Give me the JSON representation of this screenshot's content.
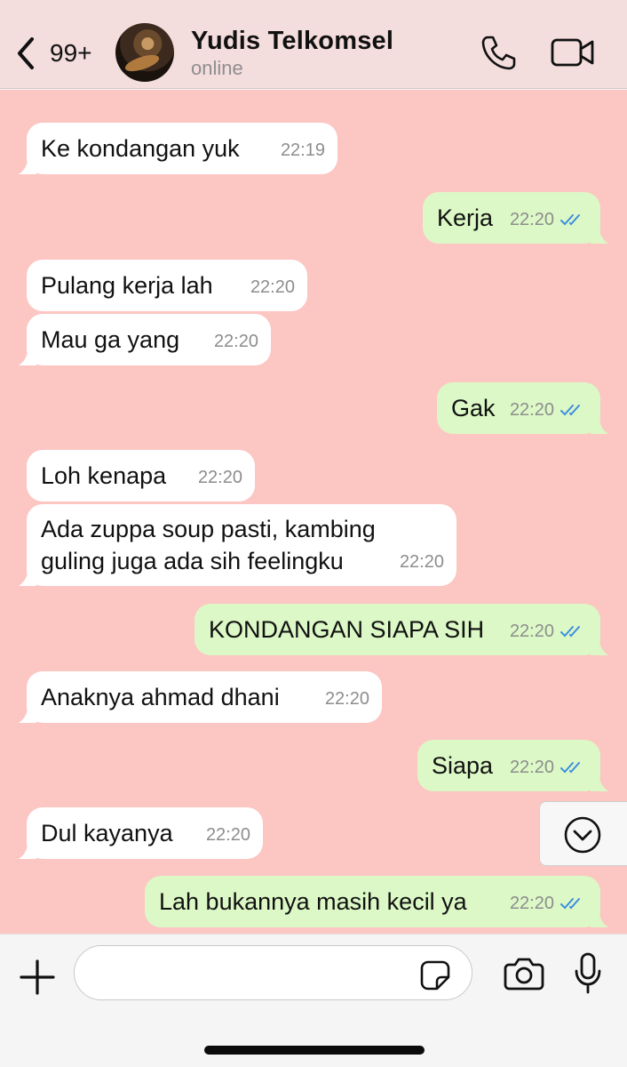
{
  "header": {
    "back_count": "99+",
    "contact_name": "Yudis Telkomsel",
    "status": "online"
  },
  "messages": [
    {
      "dir": "in",
      "text": "Ke kondangan yuk",
      "time": "22:19"
    },
    {
      "dir": "out",
      "text": "Kerja",
      "time": "22:20",
      "read": true
    },
    {
      "dir": "in",
      "text": "Pulang kerja lah",
      "time": "22:20"
    },
    {
      "dir": "in",
      "text": "Mau ga yang",
      "time": "22:20"
    },
    {
      "dir": "out",
      "text": "Gak",
      "time": "22:20",
      "read": true
    },
    {
      "dir": "in",
      "text": "Loh kenapa",
      "time": "22:20"
    },
    {
      "dir": "in",
      "text": "Ada zuppa soup pasti, kambing\nguling juga ada sih feelingku",
      "time": "22:20"
    },
    {
      "dir": "out",
      "text": "KONDANGAN SIAPA SIH",
      "time": "22:20",
      "read": true
    },
    {
      "dir": "in",
      "text": "Anaknya ahmad dhani",
      "time": "22:20"
    },
    {
      "dir": "out",
      "text": "Siapa",
      "time": "22:20",
      "read": true
    },
    {
      "dir": "in",
      "text": "Dul kayanya",
      "time": "22:20"
    },
    {
      "dir": "out",
      "text": "Lah bukannya masih kecil ya",
      "time": "22:20",
      "read": true
    }
  ],
  "composer": {
    "input_value": "",
    "input_placeholder": ""
  },
  "colors": {
    "chat_background": "#fcc6c3",
    "header_background": "#f4dddd",
    "incoming_bubble": "#ffffff",
    "outgoing_bubble": "#dcf8c6",
    "read_tick": "#3d8fe0"
  },
  "icons": {
    "back": "chevron-left-icon",
    "call": "phone-icon",
    "video": "video-camera-icon",
    "scroll_down": "chevron-down-circle-icon",
    "attach": "plus-icon",
    "sticker": "sticker-icon",
    "camera": "camera-icon",
    "mic": "microphone-icon"
  }
}
